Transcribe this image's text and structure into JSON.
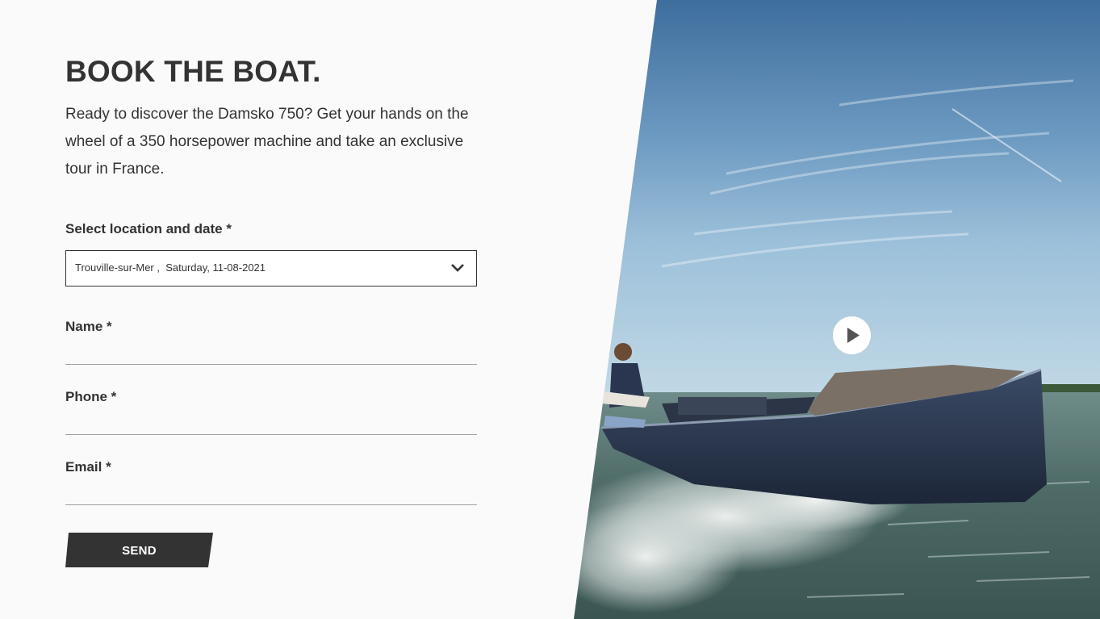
{
  "form": {
    "title": "BOOK THE BOAT.",
    "intro": "Ready to discover the Damsko 750? Get your hands on the wheel of a 350 horsepower machine and take an exclusive tour in France.",
    "location_label": "Select location and date *",
    "location_value": "Trouville-sur-Mer ,  Saturday, 11-08-2021",
    "name_label": "Name *",
    "phone_label": "Phone *",
    "email_label": "Email *",
    "send_label": "SEND"
  },
  "hero": {
    "icon": "play-icon",
    "subject": "motorboat-photo"
  },
  "colors": {
    "text": "#333333",
    "background": "#fafafa",
    "button": "#333333",
    "sky_top": "#3f6f9e",
    "water": "#4e6a66"
  }
}
